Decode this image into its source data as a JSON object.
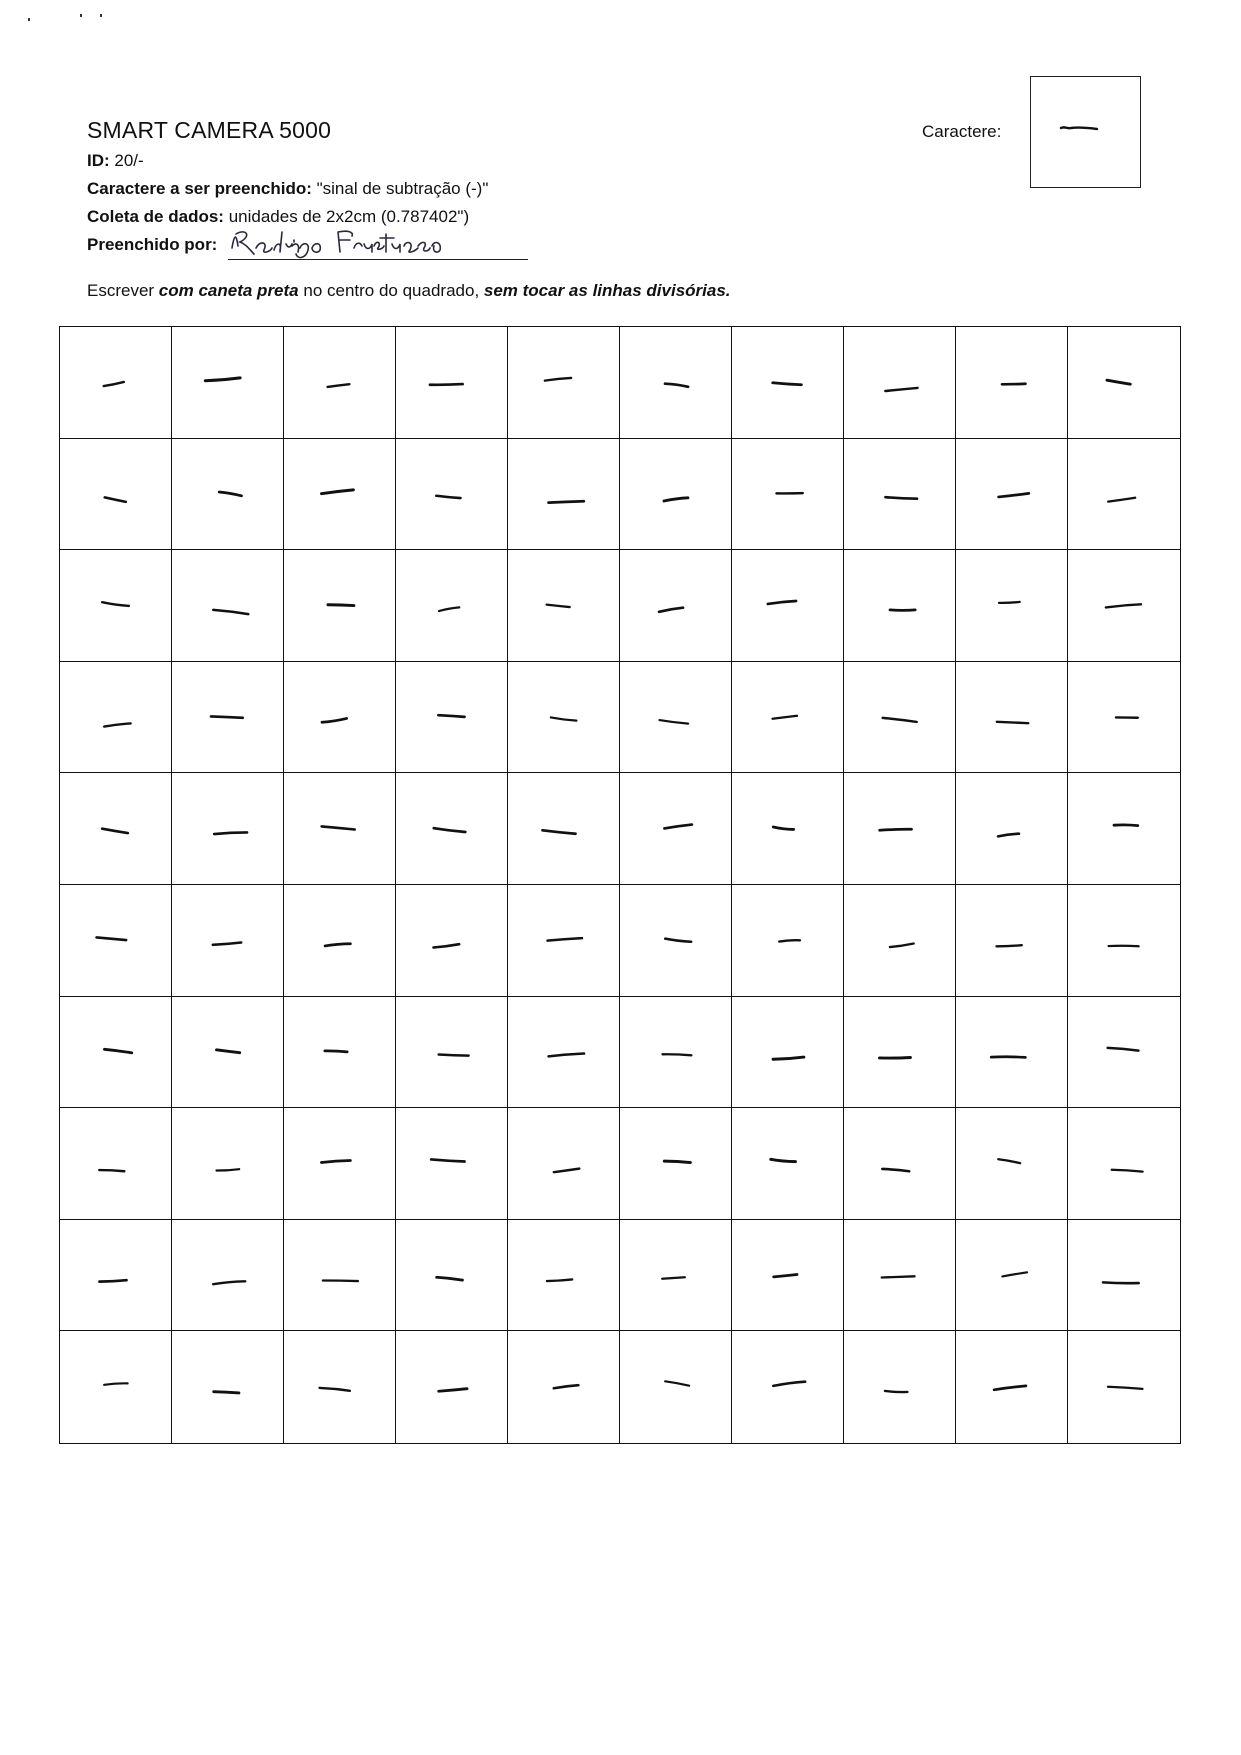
{
  "header": {
    "title": "SMART CAMERA 5000",
    "id_label": "ID:",
    "id_value": " 20/-",
    "char_label": "Caractere a ser preenchido:",
    "char_value": " \"sinal de subtração (-)\"",
    "coleta_label": "Coleta de dados:",
    "coleta_value": " unidades de 2x2cm (0.787402\")",
    "preench_label": "Preenchido por:",
    "signature_name": "Rodrigo Fructuoso"
  },
  "instruction": {
    "part1": "Escrever ",
    "part2": "com caneta preta",
    "part3": " no centro do quadrado, ",
    "part4": "sem tocar as linhas divisórias."
  },
  "caractere": {
    "label": "Caractere:",
    "sample": "-"
  },
  "grid": {
    "rows": 10,
    "columns": 10,
    "cell_character": "-",
    "ink_color": "#111111",
    "line_color": "#111111"
  }
}
